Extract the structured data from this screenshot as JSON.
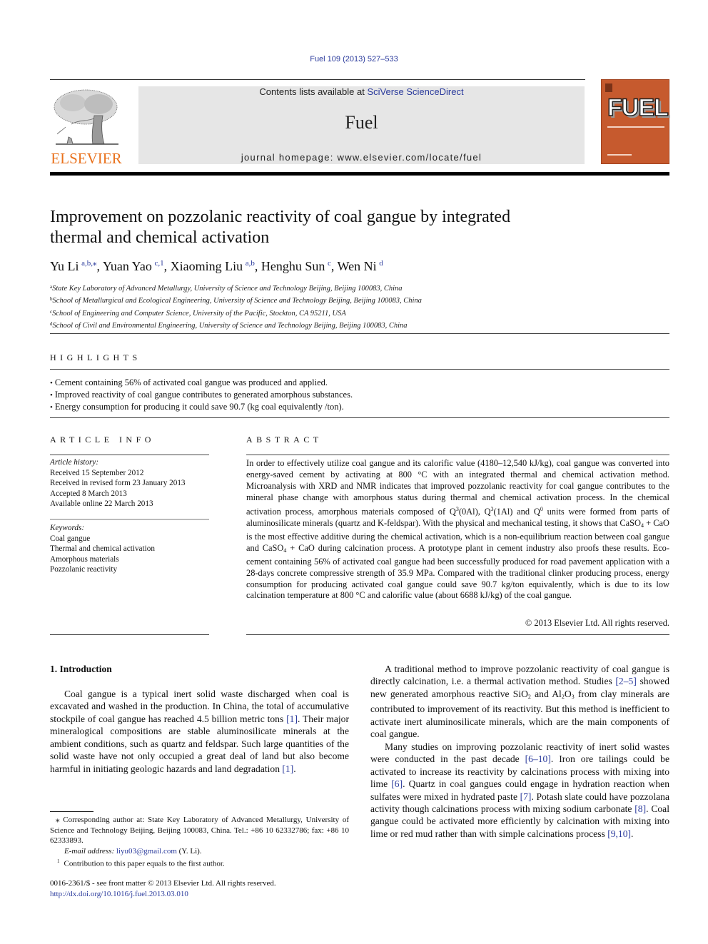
{
  "header": {
    "citation": "Fuel 109 (2013) 527–533",
    "contents_prefix": "Contents lists available at ",
    "contents_link": "SciVerse ScienceDirect",
    "journal_name": "Fuel",
    "homepage_prefix": "journal homepage: ",
    "homepage_url": "www.elsevier.com/locate/fuel",
    "publisher_logo_text": "ELSEVIER",
    "cover_title": "FUEL"
  },
  "colors": {
    "link": "#2a3a9c",
    "elsevier_orange": "#e9711c",
    "cover_orange": "#c65a2e",
    "banner_gray": "#e6e6e6"
  },
  "article": {
    "title_line1": "Improvement on pozzolanic reactivity of coal gangue by integrated",
    "title_line2": "thermal and chemical activation",
    "authors": [
      {
        "name": "Yu Li",
        "sup": "a,b,⁎",
        "sep": ", "
      },
      {
        "name": "Yuan Yao",
        "sup": "c,1",
        "sep": ", "
      },
      {
        "name": "Xiaoming Liu",
        "sup": "a,b",
        "sep": ", "
      },
      {
        "name": "Henghu Sun",
        "sup": "c",
        "sep": ", "
      },
      {
        "name": "Wen Ni",
        "sup": "d",
        "sep": ""
      }
    ],
    "affiliations": [
      {
        "mark": "a",
        "text": "State Key Laboratory of Advanced Metallurgy, University of Science and Technology Beijing, Beijing 100083, China"
      },
      {
        "mark": "b",
        "text": "School of Metallurgical and Ecological Engineering, University of Science and Technology Beijing, Beijing 100083, China"
      },
      {
        "mark": "c",
        "text": "School of Engineering and Computer Science, University of the Pacific, Stockton, CA 95211, USA"
      },
      {
        "mark": "d",
        "text": "School of Civil and Environmental Engineering, University of Science and Technology Beijing, Beijing 100083, China"
      }
    ]
  },
  "highlights": {
    "heading": "HIGHLIGHTS",
    "items": [
      "Cement containing 56% of activated coal gangue was produced and applied.",
      "Improved reactivity of coal gangue contributes to generated amorphous substances.",
      "Energy consumption for producing it could save 90.7 (kg coal equivalently /ton)."
    ]
  },
  "article_info": {
    "heading": "ARTICLE INFO",
    "history_label": "Article history:",
    "history": [
      "Received 15 September 2012",
      "Received in revised form 23 January 2013",
      "Accepted 8 March 2013",
      "Available online 22 March 2013"
    ],
    "keywords_label": "Keywords:",
    "keywords": [
      "Coal gangue",
      "Thermal and chemical activation",
      "Amorphous materials",
      "Pozzolanic reactivity"
    ]
  },
  "abstract": {
    "heading": "ABSTRACT",
    "p1": "In order to effectively utilize coal gangue and its calorific value (4180–12,540 kJ/kg), coal gangue was converted into energy-saved cement by activating at 800 °C with an integrated thermal and chemical activation method. Microanalysis with XRD and NMR indicates that improved pozzolanic reactivity for coal gangue contributes to the mineral phase change with amorphous status during thermal and chem­ical activation process. In the chemical activation process, amorphous materials composed of Q",
    "q3": "3",
    "p2": "(0Al), Q",
    "p3": "(1Al) and Q",
    "q0": "0",
    "p4": " units were formed from parts of aluminosilicate minerals (quartz and K-feldspar). With the physical and mechanical testing, it shows that CaSO",
    "sub4": "4",
    "p5": " + CaO is the most effective additive during the chemical activation, which is a non-equilibrium reaction between coal gangue and CaSO",
    "p6": " + CaO dur­ing calcination process. A prototype plant in cement industry also proofs these results. Eco-cement con­taining 56% of activated coal gangue had been successfully produced for road pavement application with a 28-days concrete compressive strength of 35.9 MPa. Compared with the traditional clinker producing process, energy consumption for producing activated coal gangue could save 90.7 kg/ton equivalently, which is due to its low calcination temperature at 800 °C and calorific value (about 6688 kJ/kg) of the coal gangue.",
    "copyright": "© 2013 Elsevier Ltd. All rights reserved."
  },
  "introduction": {
    "heading": "1. Introduction",
    "para1_a": "Coal gangue is a typical inert solid waste discharged when coal is excavated and washed in the production. In China, the total of accumulative stockpile of coal gangue has reached 4.5 billion met­ric tons ",
    "ref1": "[1]",
    "para1_b": ". Their major mineralogical compositions are stable alu­minosilicate minerals at the ambient conditions, such as quartz and feldspar. Such large quantities of the solid waste have not only occupied a great deal of land but also become harmful in initiating geologic hazards and land degradation ",
    "para1_c": ".",
    "para2_a": "A traditional method to improve pozzolanic reactivity of coal gangue is directly calcination, i.e. a thermal activation method. Studies ",
    "ref2_5": "[2–5]",
    "para2_b": " showed new generated amorphous reactive SiO",
    "sub2": "2",
    "para2_c": " and Al",
    "sub3": "3",
    "para2_d": "O",
    "para2_e": " from clay minerals are contributed to improvement of its reactivity. But this method is inefficient to activate inert alumi­nosilicate minerals, which are the main components of coal gangue.",
    "para3_a": "Many studies on improving pozzolanic reactivity of inert solid wastes were conducted in the past decade ",
    "ref6_10": "[6–10]",
    "para3_b": ". Iron ore tailings could be activated to increase its reactivity by calcinations process with mixing into lime ",
    "ref6": "[6]",
    "para3_c": ". Quartz in coal gangues could engage in hydration reaction when sulfates were mixed in hydrated paste ",
    "ref7": "[7]",
    "para3_d": ". Potash slate could have pozzolana activity though calcinations process with mixing sodium carbonate ",
    "ref8": "[8]",
    "para3_e": ". Coal gangue could be activated more efficiently by calcination with mixing into lime or red mud rather than with simple calcinations process ",
    "ref9_10": "[9,10]",
    "para3_f": "."
  },
  "footnotes": {
    "corresponding": "⁎ Corresponding author at: State Key Laboratory of Advanced Metallurgy, University of Science and Technology Beijing, Beijing 100083, China. Tel.: +86 10 62332786; fax: +86 10 62333893.",
    "email_label": "E-mail address: ",
    "email": "liyu03@gmail.com",
    "email_suffix": " (Y. Li).",
    "note1_mark": "1",
    "note1": "Contribution to this paper equals to the first author.",
    "issn": "0016-2361/$ - see front matter © 2013 Elsevier Ltd. All rights reserved.",
    "doi": "http://dx.doi.org/10.1016/j.fuel.2013.03.010"
  }
}
